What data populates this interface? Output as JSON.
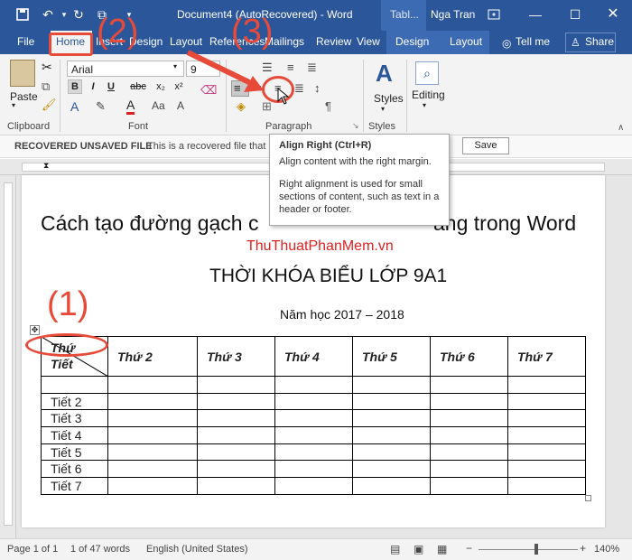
{
  "titlebar": {
    "document_title": "Document4 (AutoRecovered)  -  Word",
    "context_tab": "Tabl...",
    "user_name": "Nga Tran"
  },
  "tabs": [
    "File",
    "Home",
    "Insert",
    "Design",
    "Layout",
    "References",
    "Mailings",
    "Review",
    "View",
    "Design",
    "Layout"
  ],
  "tell_me": "Tell me",
  "share": "Share",
  "ribbon": {
    "paste_label": "Paste",
    "font_name": "Arial",
    "font_size": "9",
    "styles_label": "Styles",
    "editing_label": "Editing",
    "groups": {
      "clipboard": "Clipboard",
      "font": "Font",
      "paragraph": "Paragraph",
      "styles": "Styles"
    }
  },
  "message_bar": {
    "title": "RECOVERED UNSAVED FILE",
    "text": "This is a recovered file that i",
    "save_button": "Save"
  },
  "tooltip": {
    "title": "Align Right (Ctrl+R)",
    "line1": "Align content with the right margin.",
    "line2": "Right alignment is used for small sections of content, such as text in a header or footer."
  },
  "document": {
    "heading": "Cách tạo đường gạch c... ...ăng trong Word",
    "heading_left": "Cách tạo đường gạch c",
    "heading_right": "ăng trong Word",
    "watermark": "ThuThuatPhanMem.vn",
    "timetable_title": "THỜI KHÓA BIỂU LỚP 9A1",
    "school_year": "Năm học 2017 – 2018",
    "table": {
      "corner_top": "Thứ",
      "corner_bottom": "Tiết",
      "columns": [
        "Thứ 2",
        "Thứ 3",
        "Thứ 4",
        "Thứ 5",
        "Thứ 6",
        "Thứ 7"
      ],
      "rows": [
        "",
        "Tiết 2",
        "Tiết 3",
        "Tiết 4",
        "Tiết 5",
        "Tiết 6",
        "Tiết 7"
      ]
    }
  },
  "annotations": {
    "label1": "(1)",
    "label2": "(2)",
    "label3": "(3)",
    "color": "#e84a3a"
  },
  "statusbar": {
    "page": "Page 1 of 1",
    "words": "1 of 47 words",
    "language": "English (United States)",
    "zoom": "140%"
  },
  "colors": {
    "accent": "#2b579a",
    "watermark": "#e02020"
  }
}
